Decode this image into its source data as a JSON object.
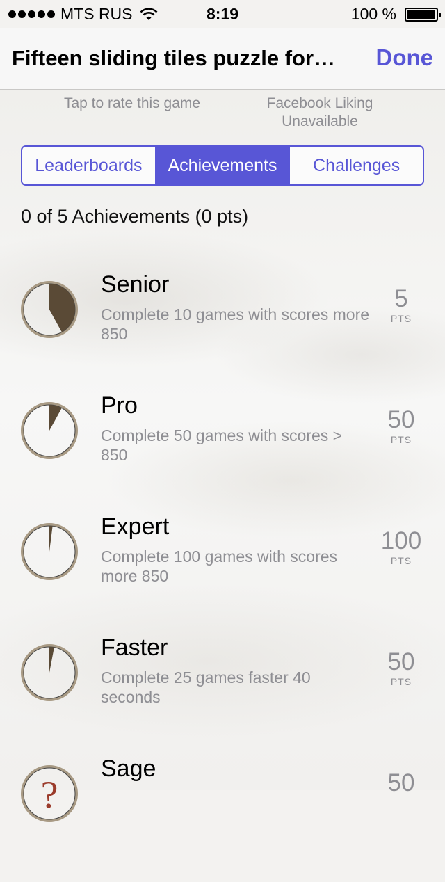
{
  "status_bar": {
    "carrier": "MTS RUS",
    "time": "8:19",
    "battery": "100 %"
  },
  "nav": {
    "title": "Fifteen sliding tiles puzzle for…",
    "done_label": "Done"
  },
  "rate": {
    "left": "Tap to rate this game",
    "right_line1": "Facebook Liking",
    "right_line2": "Unavailable"
  },
  "tabs": [
    {
      "label": "Leaderboards",
      "active": false
    },
    {
      "label": "Achievements",
      "active": true
    },
    {
      "label": "Challenges",
      "active": false
    }
  ],
  "summary": "0 of 5 Achievements (0 pts)",
  "achievements": [
    {
      "title": "Senior",
      "desc": "Complete 10 games with scores more 850",
      "pts": "5",
      "pts_label": "PTS",
      "progress": 0.42
    },
    {
      "title": "Pro",
      "desc": "Complete 50 games with scores > 850",
      "pts": "50",
      "pts_label": "PTS",
      "progress": 0.08
    },
    {
      "title": "Expert",
      "desc": "Complete 100 games with scores more 850",
      "pts": "100",
      "pts_label": "PTS",
      "progress": 0.02
    },
    {
      "title": "Faster",
      "desc": "Complete 25 games faster 40 seconds",
      "pts": "50",
      "pts_label": "PTS",
      "progress": 0.03
    },
    {
      "title": "Sage",
      "desc": "",
      "pts": "50",
      "pts_label": "PTS",
      "progress": 0
    }
  ],
  "colors": {
    "accent": "#5856d6",
    "secondary_text": "#8e8e93",
    "icon_fill": "#5a4a36"
  }
}
